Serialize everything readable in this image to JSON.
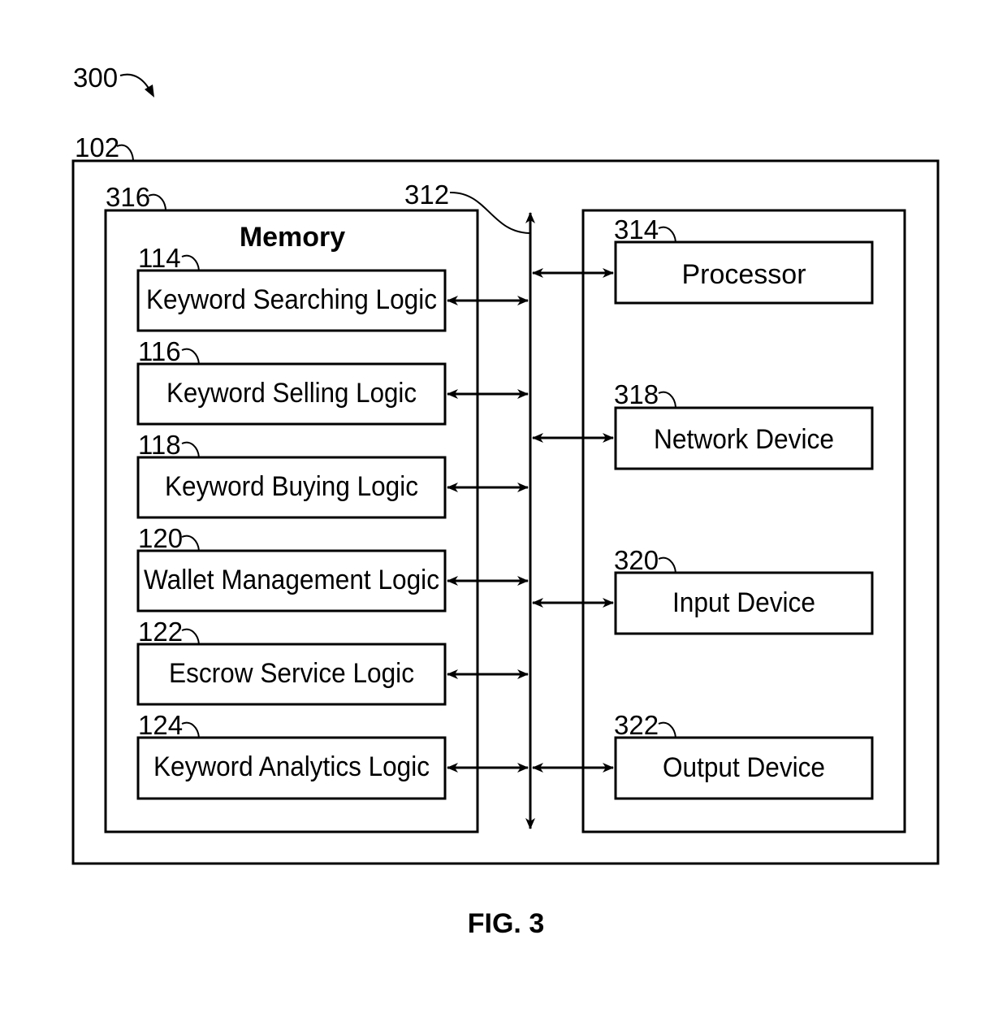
{
  "figure": {
    "caption": "FIG. 3",
    "figure_ref": "300",
    "device_ref": "102",
    "bus_ref": "312"
  },
  "memory": {
    "ref": "316",
    "title": "Memory",
    "modules": [
      {
        "ref": "114",
        "label": "Keyword Searching Logic"
      },
      {
        "ref": "116",
        "label": "Keyword Selling Logic"
      },
      {
        "ref": "118",
        "label": "Keyword Buying Logic"
      },
      {
        "ref": "120",
        "label": "Wallet Management Logic"
      },
      {
        "ref": "122",
        "label": "Escrow Service Logic"
      },
      {
        "ref": "124",
        "label": "Keyword Analytics Logic"
      }
    ]
  },
  "hardware": {
    "components": [
      {
        "ref": "314",
        "label": "Processor"
      },
      {
        "ref": "318",
        "label": "Network Device"
      },
      {
        "ref": "320",
        "label": "Input Device"
      },
      {
        "ref": "322",
        "label": "Output Device"
      }
    ]
  }
}
